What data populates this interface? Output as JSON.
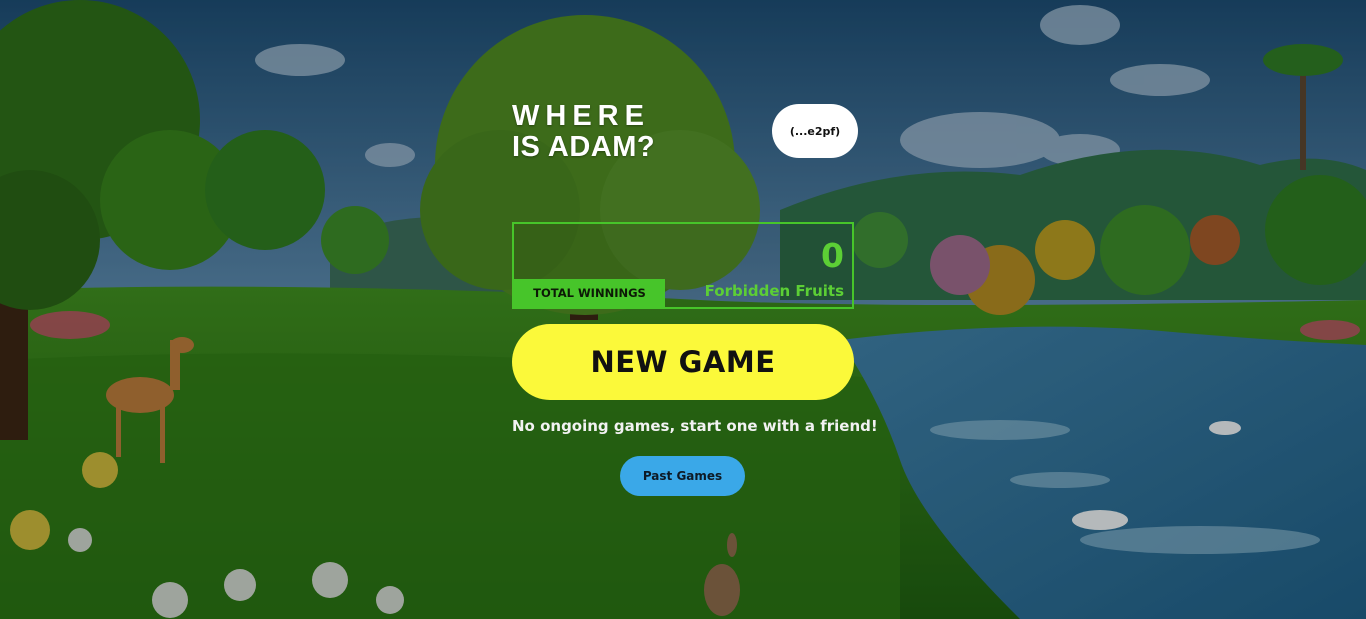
{
  "title": {
    "line1": "WHERE",
    "line2": "IS ADAM?"
  },
  "wallet": {
    "label": "(...e2pf)"
  },
  "winnings": {
    "count": "0",
    "unit": "Forbidden Fruits",
    "label": "TOTAL WINNINGS"
  },
  "actions": {
    "new_game": "NEW GAME",
    "past_games": "Past Games"
  },
  "status": {
    "message": "No ongoing games, start one with a friend!"
  },
  "colors": {
    "accent_green": "#47c52a",
    "button_yellow": "#fbf93a",
    "button_blue": "#3aa8e8"
  }
}
